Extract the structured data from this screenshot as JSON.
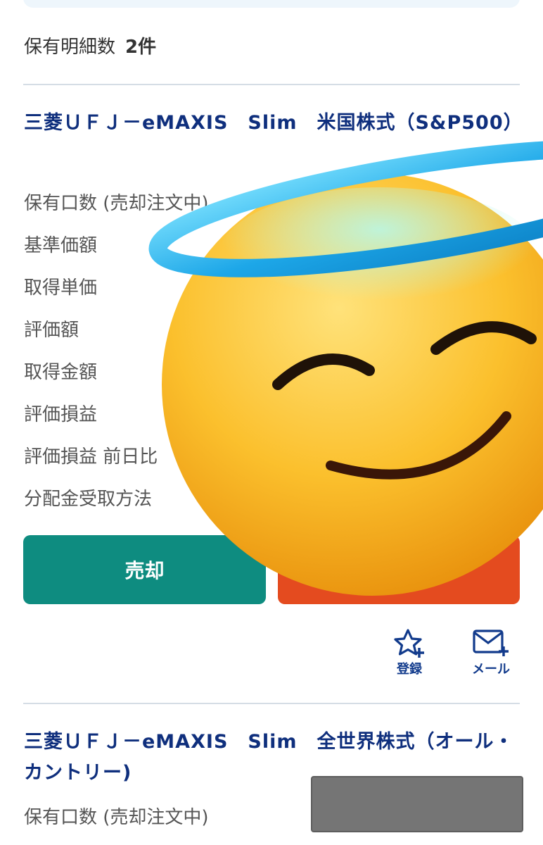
{
  "summary": {
    "label": "保有明細数",
    "count": "2件"
  },
  "funds": [
    {
      "title": "三菱ＵＦＪ－eMAXIS　Slim　米国株式（S&P500）",
      "rows": [
        "保有口数 (売却注文中)",
        "基準価額",
        "取得単価",
        "評価額",
        "取得金額",
        "評価損益",
        "評価損益 前日比",
        "分配金受取方法"
      ],
      "buttons": {
        "sell": "売却"
      },
      "actions": {
        "register": "登録",
        "mail": "メール"
      }
    },
    {
      "title": "三菱ＵＦＪ－eMAXIS　Slim　全世界株式（オール・カントリー)",
      "rows": [
        "保有口数 (売却注文中)"
      ]
    }
  ],
  "overlay": {
    "emoji": "smiling-face-with-halo"
  },
  "colors": {
    "sell": "#0e8c80",
    "buy": "#e44b1f",
    "title": "#0f2f7d",
    "action": "#123b8c"
  }
}
